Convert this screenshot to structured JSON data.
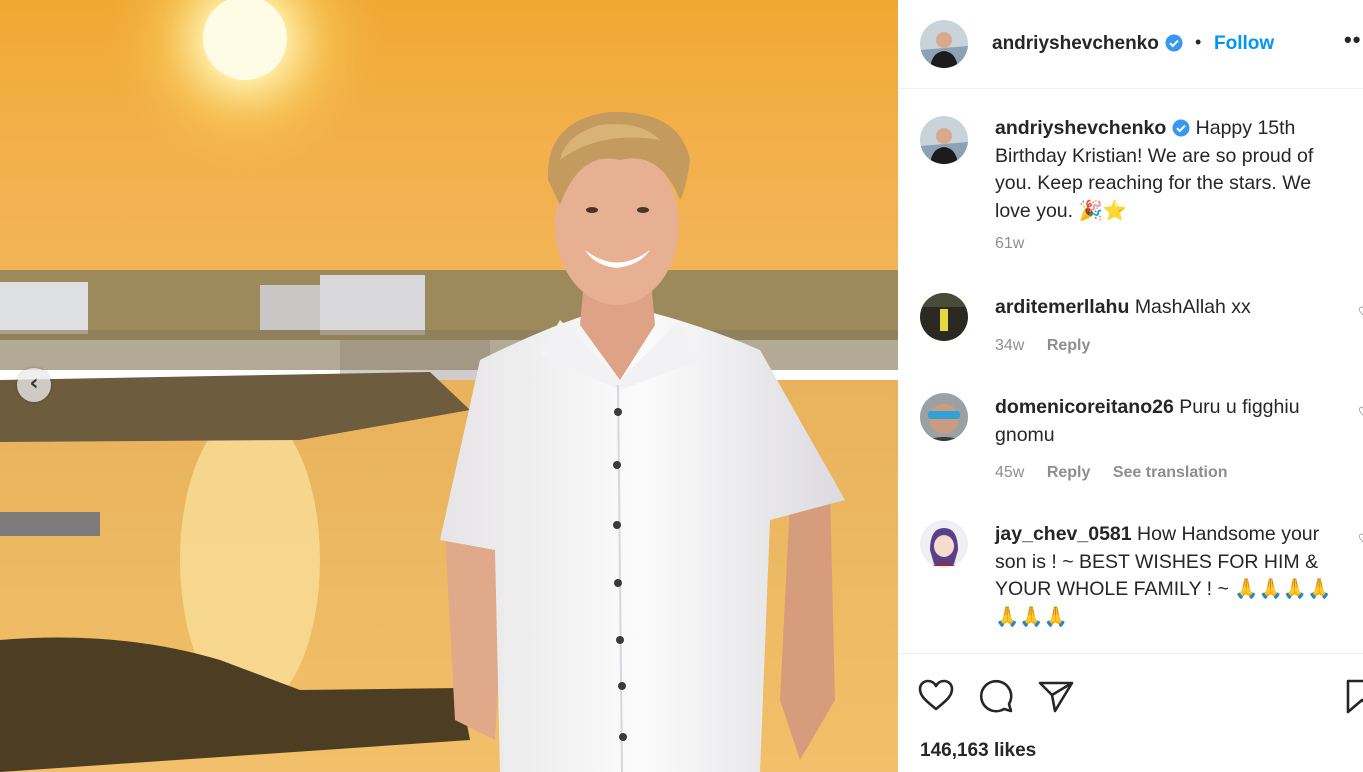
{
  "post": {
    "username": "andriyshevchenko",
    "follow_label": "Follow",
    "dot_separator": "•",
    "more_label": "••",
    "caption": "Happy 15th Birthday Kristian! We are so proud of you. Keep reaching for the stars. We love you. 🎉⭐",
    "caption_time": "61w",
    "likes": "146,163 likes"
  },
  "carousel": {
    "prev_icon": "‹"
  },
  "comments": [
    {
      "username": "arditemerllahu",
      "text": "MashAllah xx",
      "time": "34w",
      "reply": "Reply",
      "translate": ""
    },
    {
      "username": "domenicoreitano26",
      "text": "Puru u figghiu gnomu",
      "time": "45w",
      "reply": "Reply",
      "translate": "See translation"
    },
    {
      "username": "jay_chev_0581",
      "text": "How Handsome your son is ! ~ BEST WISHES FOR HIM & YOUR WHOLE FAMILY ! ~ 🙏🙏🙏🙏🙏🙏🙏",
      "time": "",
      "reply": "",
      "translate": ""
    }
  ],
  "icons": {
    "like": "heart-icon",
    "comment": "comment-icon",
    "share": "paper-plane-icon",
    "save": "bookmark-icon",
    "verified": "verified-badge-icon"
  },
  "colors": {
    "accent": "#0095f6",
    "verified": "#3897f0",
    "text": "#262626",
    "muted": "#8e8e8e"
  }
}
